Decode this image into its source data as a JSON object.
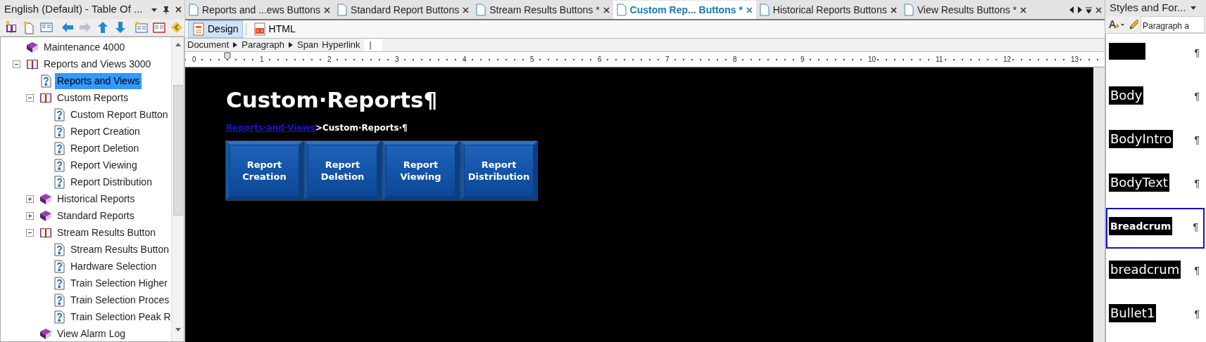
{
  "toc_panel": {
    "title": "English (Default) - Table Of ...",
    "tree": [
      {
        "label": "Maintenance 4000",
        "kind": "book",
        "selected": false
      },
      {
        "label": "Reports and Views 3000",
        "kind": "book",
        "selected": false,
        "expanded": true,
        "children": [
          {
            "label": "Reports and Views",
            "kind": "topic",
            "selected": true
          },
          {
            "label": "Custom Reports",
            "kind": "book",
            "selected": false,
            "expanded": true,
            "children": [
              {
                "label": "Custom Report Button",
                "kind": "topic",
                "selected": false
              },
              {
                "label": "Report Creation",
                "kind": "topic",
                "selected": false
              },
              {
                "label": "Report Deletion",
                "kind": "topic",
                "selected": false
              },
              {
                "label": "Report Viewing",
                "kind": "topic",
                "selected": false
              },
              {
                "label": "Report Distribution",
                "kind": "topic",
                "selected": false
              }
            ]
          },
          {
            "label": "Historical Reports",
            "kind": "book",
            "selected": false,
            "expanded": false
          },
          {
            "label": "Standard Reports",
            "kind": "book",
            "selected": false,
            "expanded": false
          },
          {
            "label": "Stream Results Button",
            "kind": "book",
            "selected": false,
            "expanded": true,
            "children": [
              {
                "label": "Stream Results Button",
                "kind": "topic",
                "selected": false
              },
              {
                "label": "Hardware Selection",
                "kind": "topic",
                "selected": false
              },
              {
                "label": "Train Selection Higher",
                "kind": "topic",
                "selected": false
              },
              {
                "label": "Train Selection Proces",
                "kind": "topic",
                "selected": false
              },
              {
                "label": "Train Selection Peak R",
                "kind": "topic",
                "selected": false
              }
            ]
          },
          {
            "label": "View Alarm Log",
            "kind": "book",
            "selected": false
          }
        ]
      }
    ]
  },
  "editor": {
    "tabs": [
      {
        "label": "Reports and ...ews Buttons",
        "selected": false
      },
      {
        "label": "Standard Report Buttons",
        "selected": false
      },
      {
        "label": "Stream Results Buttons *",
        "selected": false
      },
      {
        "label": "Custom Rep... Buttons *",
        "selected": true
      },
      {
        "label": "Historical Reports Buttons",
        "selected": false
      },
      {
        "label": "View Results Buttons *",
        "selected": false
      }
    ],
    "view_modes": [
      {
        "label": "Design",
        "selected": true
      },
      {
        "label": "HTML",
        "selected": false
      }
    ],
    "element_path": [
      "Document",
      "Paragraph",
      "Span",
      "Hyperlink"
    ],
    "path_field": {
      "value": "|"
    },
    "ruler": [
      "0",
      "1",
      "2",
      "3",
      "4",
      "5",
      "6",
      "7",
      "8",
      "9",
      "10",
      "11",
      "12",
      "13"
    ],
    "document": {
      "heading": "Custom·Reports¶",
      "breadcrumb_link": "Reports·and·Views",
      "breadcrumb_rest": ">Custom·Reports·¶",
      "buttons": [
        "Report Creation",
        "Report Deletion",
        "Report Viewing",
        "Report Distribution"
      ]
    }
  },
  "styles_panel": {
    "title": "Styles and For...",
    "filter": {
      "value": "Paragraph a"
    },
    "styles": [
      {
        "pilcrow": "¶",
        "selected": false
      },
      {
        "label": "Body",
        "pilcrow": "¶",
        "selected": false,
        "bold": false
      },
      {
        "label": "BodyIntro",
        "pilcrow": "¶",
        "selected": false,
        "bold": false
      },
      {
        "label": "BodyText",
        "pilcrow": "¶",
        "selected": false,
        "bold": false
      },
      {
        "label": "Breadcrum",
        "pilcrow": "¶",
        "selected": true,
        "bold": true
      },
      {
        "label": "breadcrum",
        "pilcrow": "¶",
        "selected": false,
        "bold": false
      },
      {
        "label": "Bullet1",
        "pilcrow": "¶",
        "selected": false,
        "bold": false
      }
    ]
  }
}
